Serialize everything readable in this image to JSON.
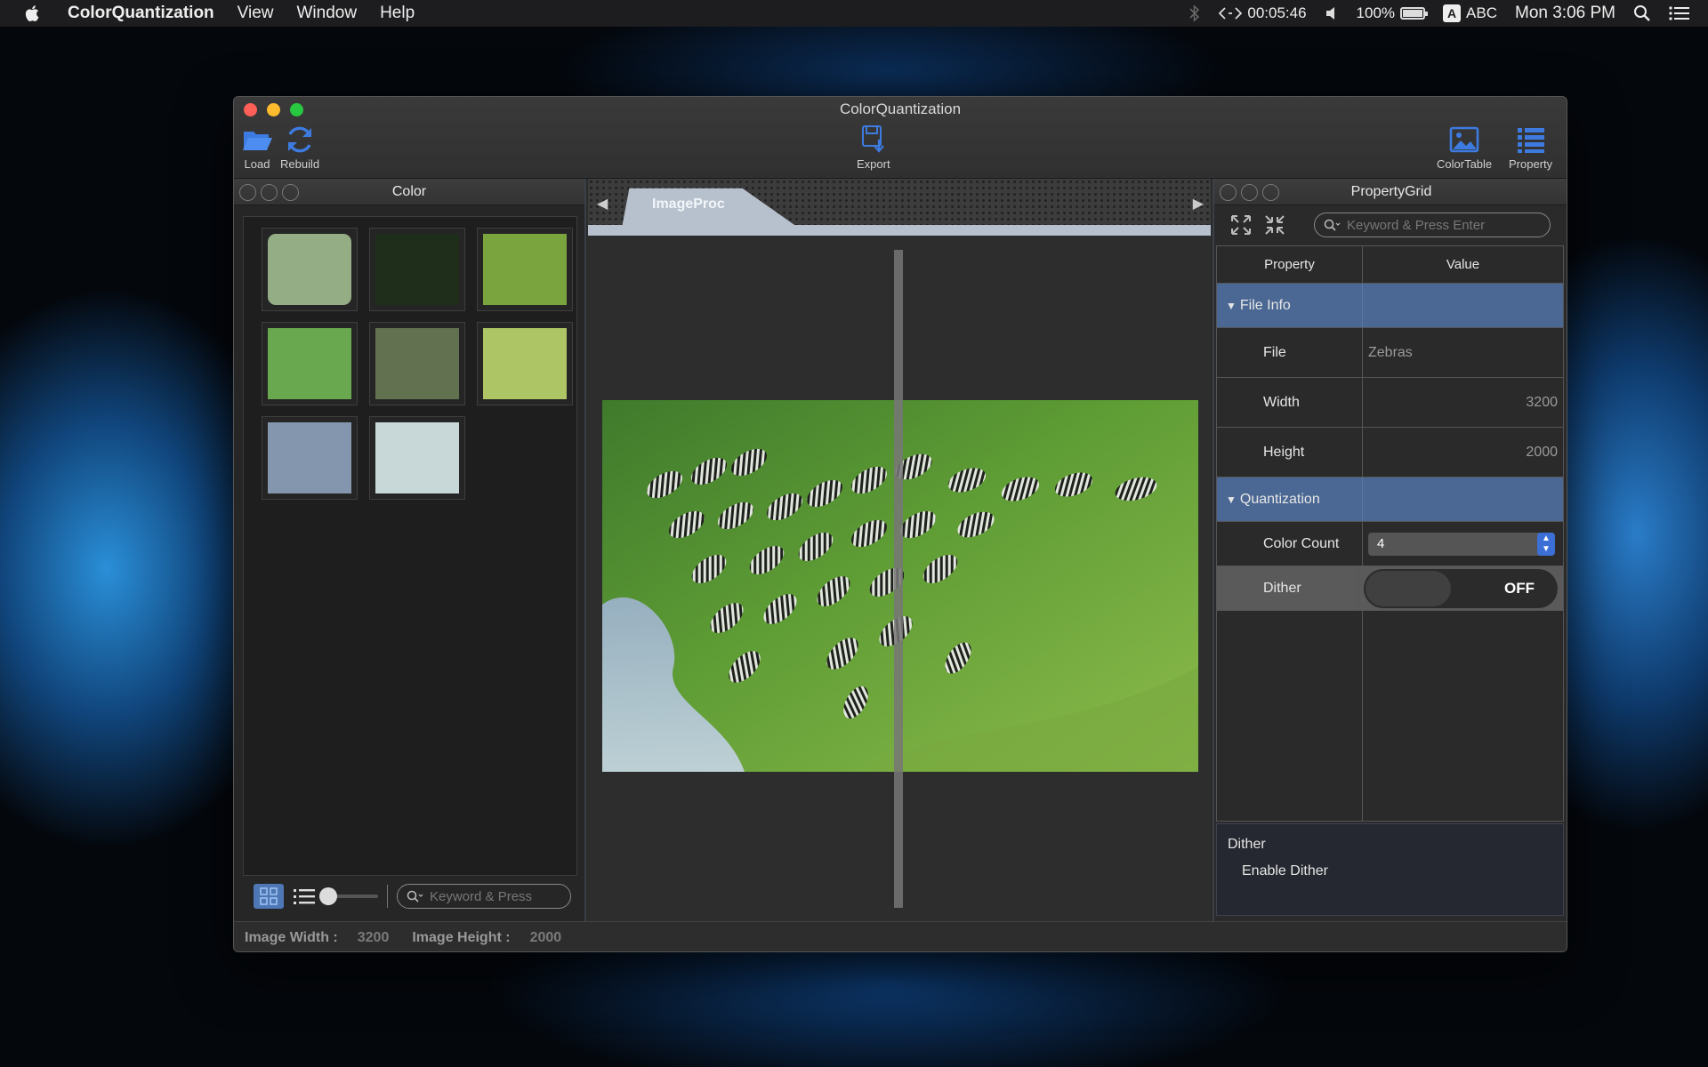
{
  "menubar": {
    "app_name": "ColorQuantization",
    "items": [
      "View",
      "Window",
      "Help"
    ],
    "timer": "00:05:46",
    "battery": "100%",
    "input_letter": "A",
    "input_source": "ABC",
    "clock": "Mon 3:06 PM"
  },
  "window": {
    "title": "ColorQuantization",
    "toolbar": {
      "load": "Load",
      "rebuild": "Rebuild",
      "export": "Export",
      "colortable": "ColorTable",
      "property": "Property"
    }
  },
  "color_panel": {
    "title": "Color",
    "swatches": [
      "#94ad85",
      "#1f2d1b",
      "#7aa53e",
      "#6aa850",
      "#627251",
      "#aec566",
      "#8396ad",
      "#c8d8d9"
    ],
    "search_placeholder": "Keyword & Press"
  },
  "center": {
    "tab_label": "ImageProc"
  },
  "property_panel": {
    "title": "PropertyGrid",
    "search_placeholder": "Keyword & Press Enter",
    "col_property": "Property",
    "col_value": "Value",
    "categories": {
      "file_info": "File Info",
      "quantization": "Quantization"
    },
    "rows": {
      "file_label": "File",
      "file_value": "Zebras",
      "width_label": "Width",
      "width_value": "3200",
      "height_label": "Height",
      "height_value": "2000",
      "color_count_label": "Color Count",
      "color_count_value": "4",
      "dither_label": "Dither",
      "dither_value": "OFF"
    },
    "description": {
      "title": "Dither",
      "text": "Enable Dither"
    }
  },
  "statusbar": {
    "image_width_label": "Image Width :",
    "image_width_value": "3200",
    "image_height_label": "Image Height :",
    "image_height_value": "2000"
  },
  "colors": {
    "accent": "#3d7be0",
    "category_row": "#4b6894",
    "tab": "#b7c1cd"
  }
}
